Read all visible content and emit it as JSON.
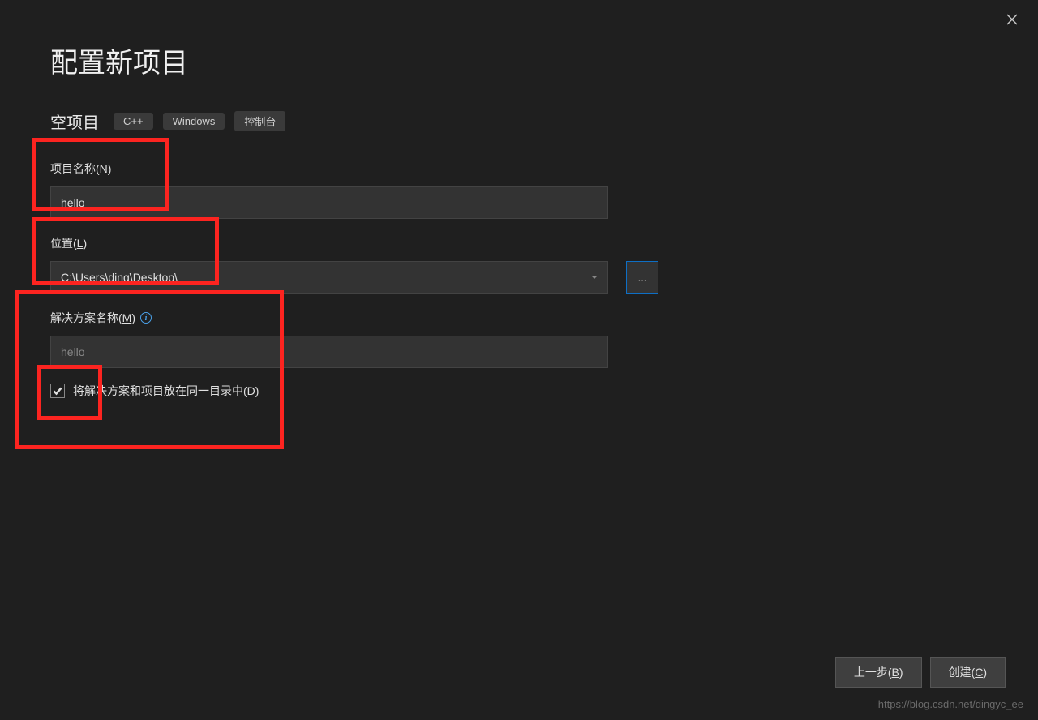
{
  "header": {
    "title": "配置新项目"
  },
  "project_type": {
    "label": "空项目",
    "tags": [
      "C++",
      "Windows",
      "控制台"
    ]
  },
  "fields": {
    "project_name": {
      "label_pre": "项目名称(",
      "label_key": "N",
      "label_post": ")",
      "value": "hello"
    },
    "location": {
      "label_pre": "位置(",
      "label_key": "L",
      "label_post": ")",
      "value": "C:\\Users\\ding\\Desktop\\",
      "browse_label": "..."
    },
    "solution_name": {
      "label_pre": "解决方案名称(",
      "label_key": "M",
      "label_post": ")",
      "placeholder": "hello"
    },
    "same_dir_checkbox": {
      "checked": true,
      "label_pre": "将解决方案和项目放在同一目录中(",
      "label_key": "D",
      "label_post": ")"
    }
  },
  "footer": {
    "back": {
      "pre": "上一步(",
      "key": "B",
      "post": ")"
    },
    "create": {
      "pre": "创建(",
      "key": "C",
      "post": ")"
    }
  },
  "watermark": "https://blog.csdn.net/dingyc_ee"
}
